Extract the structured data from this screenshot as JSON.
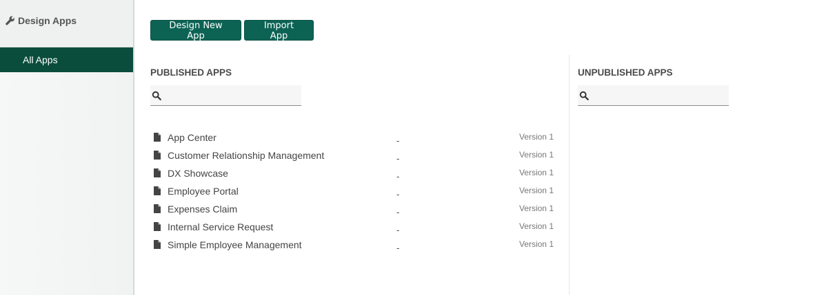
{
  "sidebar": {
    "title": "Design Apps",
    "icon": "wrench-icon",
    "items": [
      {
        "label": "All Apps",
        "active": true
      }
    ]
  },
  "toolbar": {
    "design_new_label": "Design New App",
    "import_label": "Import App"
  },
  "published": {
    "title": "PUBLISHED APPS",
    "search_value": "",
    "apps": [
      {
        "name": "App Center",
        "dash": "-",
        "version": "Version 1"
      },
      {
        "name": "Customer Relationship Management",
        "dash": "-",
        "version": "Version 1"
      },
      {
        "name": "DX Showcase",
        "dash": "-",
        "version": "Version 1"
      },
      {
        "name": "Employee Portal",
        "dash": "-",
        "version": "Version 1"
      },
      {
        "name": "Expenses Claim",
        "dash": "-",
        "version": "Version 1"
      },
      {
        "name": "Internal Service Request",
        "dash": "-",
        "version": "Version 1"
      },
      {
        "name": "Simple Employee Management",
        "dash": "-",
        "version": "Version 1"
      }
    ]
  },
  "unpublished": {
    "title": "UNPUBLISHED APPS",
    "search_value": ""
  },
  "colors": {
    "accent": "#0c6354",
    "nav_active": "#0a4d3d"
  }
}
